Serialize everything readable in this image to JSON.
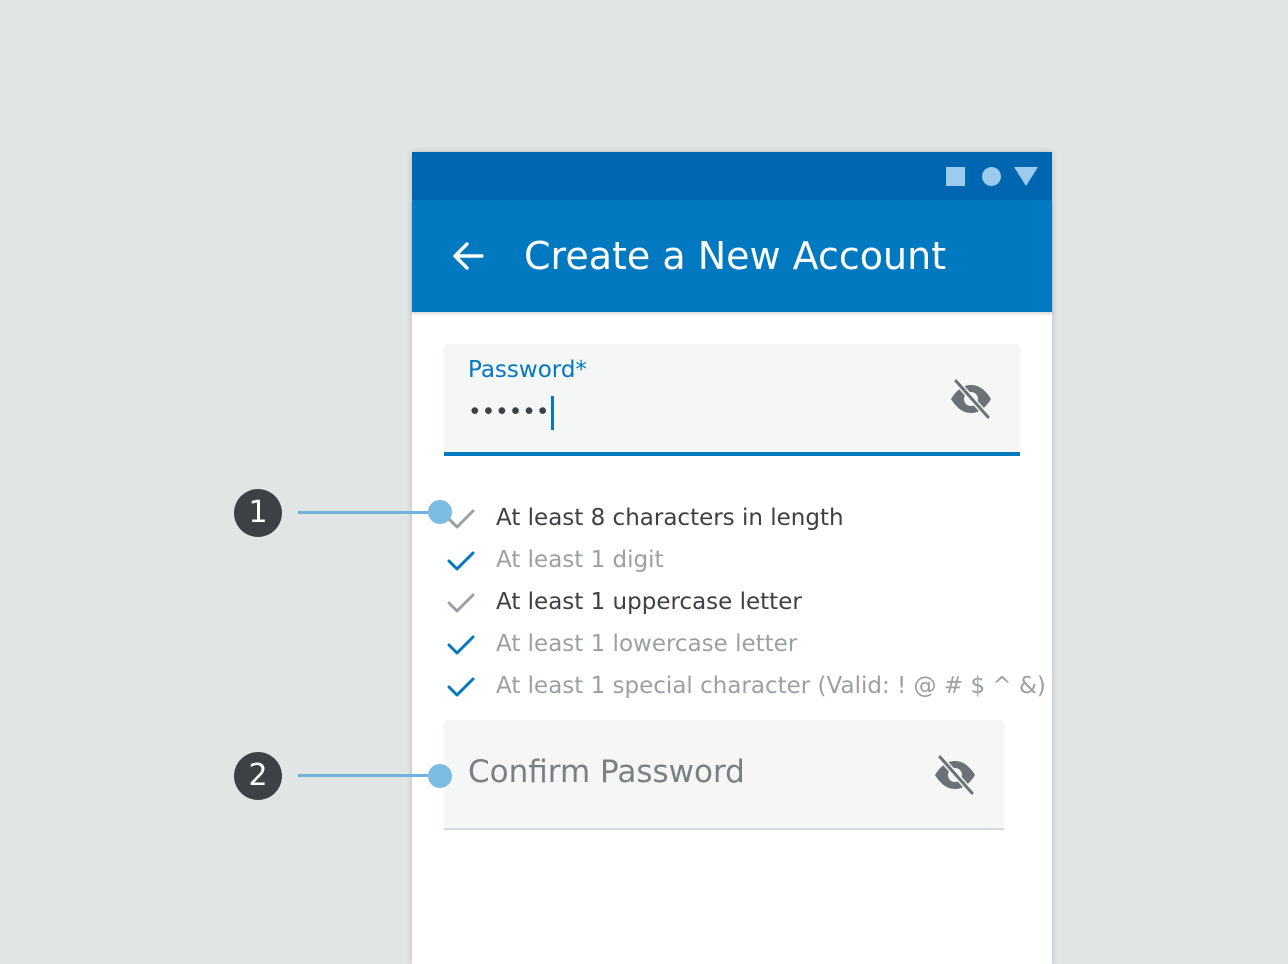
{
  "status_bar": {
    "icons": [
      "square-icon",
      "circle-icon",
      "triangle-icon"
    ],
    "color": "#0066b1",
    "icon_color": "#9ccbee"
  },
  "app_bar": {
    "title": "Create a New Account",
    "back_icon": "arrow-left-icon",
    "color": "#0079c1"
  },
  "password_field": {
    "label": "Password*",
    "value": "••••••",
    "visibility_icon": "eye-off-icon"
  },
  "requirements": [
    {
      "label": "At least 8 characters in length",
      "met": false
    },
    {
      "label": "At least 1 digit",
      "met": true
    },
    {
      "label": "At least 1 uppercase letter",
      "met": false
    },
    {
      "label": "At least 1 lowercase letter",
      "met": true
    },
    {
      "label": "At least 1 special character (Valid: ! @ # $ ^ &)",
      "met": true
    }
  ],
  "confirm_password_field": {
    "placeholder": "Confirm Password",
    "visibility_icon": "eye-off-icon"
  },
  "annotations": [
    "1",
    "2"
  ],
  "colors": {
    "accent": "#0079c1",
    "check_met": "#0079c1",
    "check_unmet": "#9aa0a4",
    "background": "#e1e5e6",
    "annotation_badge": "#3c4145",
    "annotation_marker": "#7bbde2"
  }
}
